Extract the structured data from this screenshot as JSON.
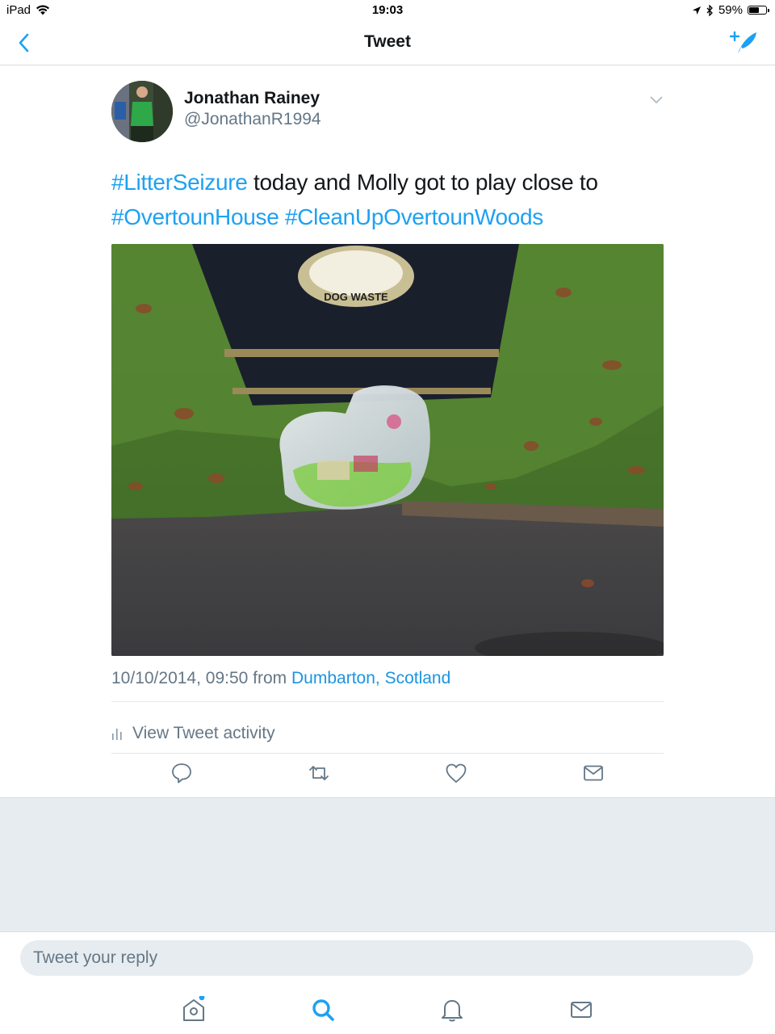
{
  "status_bar": {
    "device": "iPad",
    "time": "19:03",
    "battery": "59%",
    "battery_level": 0.59
  },
  "nav": {
    "title": "Tweet",
    "back_icon": "chevron-left-icon",
    "compose_icon": "compose-tweet-icon"
  },
  "tweet": {
    "author_name": "Jonathan Rainey",
    "author_handle": "@JonathanR1994",
    "text_parts": {
      "hashtag1": "#LitterSeizure",
      "plain1": " today and Molly got to play close to",
      "hashtag2": "#OvertounHouse",
      "space": " ",
      "hashtag3": "#CleanUpOvertounWoods"
    },
    "timestamp": "10/10/2014, 09:50",
    "from_label": "from",
    "location": "Dumbarton, Scotland",
    "view_activity": "View Tweet activity",
    "bin_label": "DOG WASTE"
  },
  "actions": {
    "reply_icon": "reply-icon",
    "retweet_icon": "retweet-icon",
    "like_icon": "heart-icon",
    "dm_icon": "envelope-icon"
  },
  "reply": {
    "placeholder": "Tweet your reply"
  },
  "tabs": [
    "home-icon",
    "search-icon",
    "notifications-icon",
    "messages-icon"
  ],
  "colors": {
    "accent": "#1da1f2",
    "text": "#14171a",
    "secondary": "#657786",
    "background_gray": "#e6ecf0"
  }
}
